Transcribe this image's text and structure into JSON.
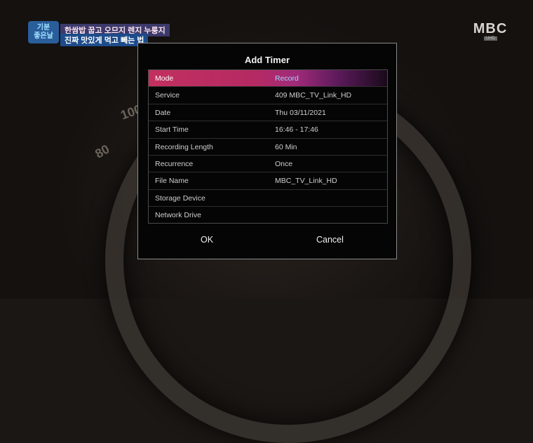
{
  "overlay": {
    "logo_text": "기분\n좋은날",
    "line1": "한쌈밥 꿉고 오므지 렌지 누룽지",
    "line2": "진짜 맛있게 먹고 빼는 법"
  },
  "channel": {
    "logo": "MBC",
    "sub": "UHD"
  },
  "dialog": {
    "title": "Add Timer",
    "rows": [
      {
        "label": "Mode",
        "value": "Record"
      },
      {
        "label": "Service",
        "value": "409 MBC_TV_Link_HD"
      },
      {
        "label": "Date",
        "value": "Thu 03/11/2021"
      },
      {
        "label": "Start Time",
        "value": "16:46 - 17:46"
      },
      {
        "label": "Recording Length",
        "value": "60 Min"
      },
      {
        "label": "Recurrence",
        "value": "Once"
      },
      {
        "label": "File Name",
        "value": "MBC_TV_Link_HD"
      },
      {
        "label": "Storage Device",
        "value": ""
      },
      {
        "label": "Network Drive",
        "value": ""
      }
    ],
    "ok_label": "OK",
    "cancel_label": "Cancel"
  },
  "background_marks": [
    "100",
    "80"
  ]
}
